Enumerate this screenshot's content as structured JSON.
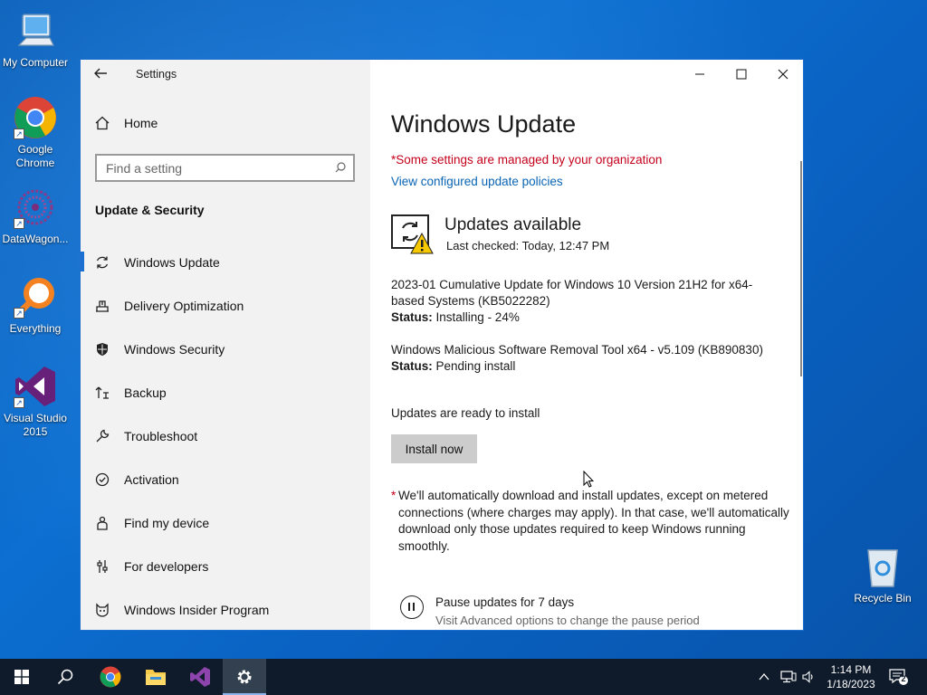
{
  "desktop": {
    "icons": [
      {
        "label": "My Computer"
      },
      {
        "label": "Google Chrome"
      },
      {
        "label": "DataWagon..."
      },
      {
        "label": "Everything"
      },
      {
        "label": "Visual Studio 2015"
      },
      {
        "label": "Recycle Bin"
      }
    ]
  },
  "window": {
    "title": "Settings",
    "controls": {
      "minimize": "minimize-icon",
      "maximize": "maximize-icon",
      "close": "close-icon"
    }
  },
  "sidebar": {
    "home_label": "Home",
    "search_placeholder": "Find a setting",
    "section_title": "Update & Security",
    "items": [
      {
        "label": "Windows Update",
        "icon": "sync-icon",
        "active": true
      },
      {
        "label": "Delivery Optimization",
        "icon": "delivery-optimization-icon"
      },
      {
        "label": "Windows Security",
        "icon": "shield-icon"
      },
      {
        "label": "Backup",
        "icon": "backup-icon"
      },
      {
        "label": "Troubleshoot",
        "icon": "wrench-icon"
      },
      {
        "label": "Activation",
        "icon": "check-circle-icon"
      },
      {
        "label": "Find my device",
        "icon": "person-pin-icon"
      },
      {
        "label": "For developers",
        "icon": "developer-settings-icon"
      },
      {
        "label": "Windows Insider Program",
        "icon": "insider-cat-icon"
      }
    ]
  },
  "main": {
    "title": "Windows Update",
    "managed_notice": "*Some settings are managed by your organization",
    "policies_link": "View configured update policies",
    "status_heading": "Updates available",
    "last_checked": "Last checked: Today, 12:47 PM",
    "updates": [
      {
        "name": "2023-01 Cumulative Update for Windows 10 Version 21H2 for x64-based Systems (KB5022282)",
        "status_label": "Status:",
        "status_value": "Installing - 24%"
      },
      {
        "name": "Windows Malicious Software Removal Tool x64 - v5.109 (KB890830)",
        "status_label": "Status:",
        "status_value": "Pending install"
      }
    ],
    "ready_text": "Updates are ready to install",
    "install_button": "Install now",
    "note_star": "*",
    "note_text": "We'll automatically download and install updates, except on metered connections (where charges may apply). In that case, we'll automatically download only those updates required to keep Windows running smoothly.",
    "pause_title": "Pause updates for 7 days",
    "pause_subtitle": "Visit Advanced options to change the pause period"
  },
  "taskbar": {
    "items": [
      "start-icon",
      "search-icon",
      "chrome-icon",
      "file-explorer-icon",
      "visual-studio-icon",
      "settings-gear-icon"
    ],
    "active": "settings-gear-icon",
    "time": "1:14 PM",
    "date": "1/18/2023",
    "notification_count": "2"
  },
  "colors": {
    "accent": "#1a6fd0",
    "warning_text": "#c4001b",
    "link": "#0a64b4",
    "sidebar_bg": "#f2f2f2",
    "taskbar_bg": "#0f1b2b"
  }
}
